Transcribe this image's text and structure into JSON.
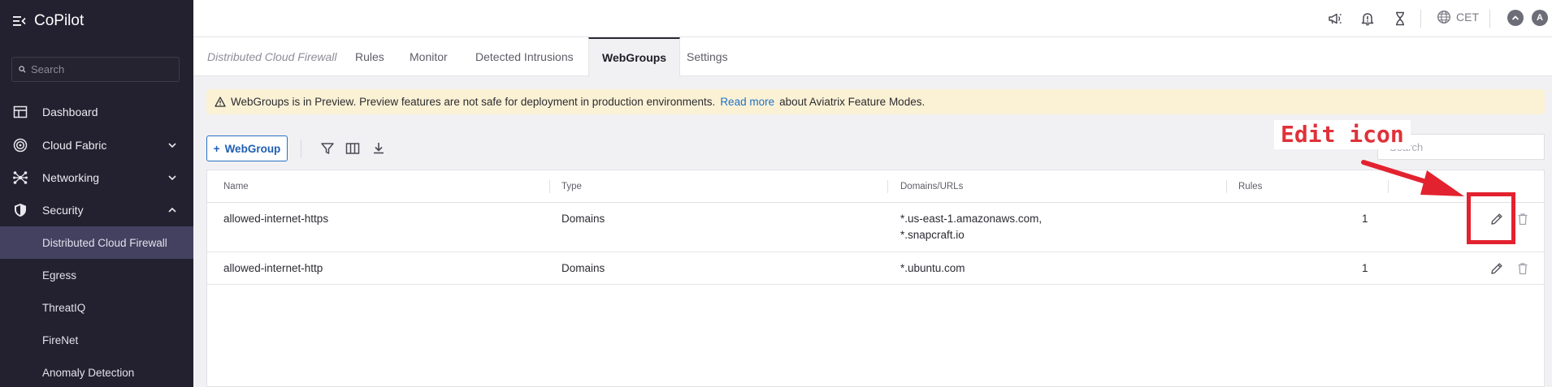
{
  "app": {
    "title": "CoPilot"
  },
  "sidebar": {
    "search_placeholder": "Search",
    "items": [
      {
        "label": "Dashboard"
      },
      {
        "label": "Cloud Fabric"
      },
      {
        "label": "Networking"
      },
      {
        "label": "Security"
      }
    ],
    "security_children": [
      {
        "label": "Distributed Cloud Firewall"
      },
      {
        "label": "Egress"
      },
      {
        "label": "ThreatIQ"
      },
      {
        "label": "FireNet"
      },
      {
        "label": "Anomaly Detection"
      }
    ]
  },
  "topbar": {
    "timezone": "CET",
    "avatar_initial": "A"
  },
  "tabs": {
    "context": "Distributed Cloud Firewall",
    "items": [
      "Rules",
      "Monitor",
      "Detected Intrusions",
      "WebGroups",
      "Settings"
    ]
  },
  "banner": {
    "text_before": "WebGroups is in Preview. Preview features are not safe for deployment in production environments.",
    "link": "Read more",
    "text_after": "about Aviatrix Feature Modes."
  },
  "toolbar": {
    "add_label": "WebGroup",
    "search_placeholder": "Search"
  },
  "table": {
    "headers": {
      "name": "Name",
      "type": "Type",
      "domains": "Domains/URLs",
      "rules": "Rules"
    },
    "rows": [
      {
        "name": "allowed-internet-https",
        "type": "Domains",
        "domains_line1": "*.us-east-1.amazonaws.com,",
        "domains_line2": "*.snapcraft.io",
        "rules": "1"
      },
      {
        "name": "allowed-internet-http",
        "type": "Domains",
        "domains_line1": "*.ubuntu.com",
        "domains_line2": "",
        "rules": "1"
      }
    ]
  },
  "annotation": {
    "label": "Edit icon",
    "color": "#e3222f"
  }
}
